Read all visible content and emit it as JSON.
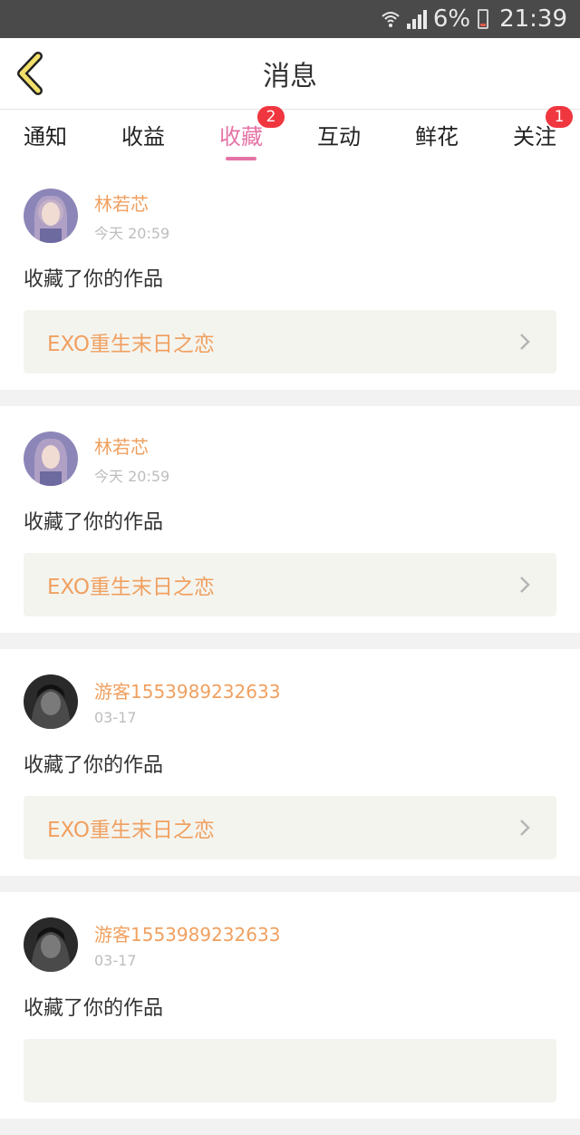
{
  "status_bar": {
    "battery_percent": "6%",
    "time": "21:39"
  },
  "header": {
    "title": "消息"
  },
  "tabs": [
    {
      "label": "通知",
      "active": false,
      "badge": ""
    },
    {
      "label": "收益",
      "active": false,
      "badge": ""
    },
    {
      "label": "收藏",
      "active": true,
      "badge": "2"
    },
    {
      "label": "互动",
      "active": false,
      "badge": ""
    },
    {
      "label": "鲜花",
      "active": false,
      "badge": ""
    },
    {
      "label": "关注",
      "active": false,
      "badge": "1"
    }
  ],
  "messages": [
    {
      "username": "林若芯",
      "time": "今天 20:59",
      "action": "收藏了你的作品",
      "work": "EXO重生末日之恋",
      "avatar": "light"
    },
    {
      "username": "林若芯",
      "time": "今天 20:59",
      "action": "收藏了你的作品",
      "work": "EXO重生末日之恋",
      "avatar": "light"
    },
    {
      "username": "游客1553989232633",
      "time": "03-17",
      "action": "收藏了你的作品",
      "work": "EXO重生末日之恋",
      "avatar": "dark"
    },
    {
      "username": "游客1553989232633",
      "time": "03-17",
      "action": "收藏了你的作品",
      "work": "",
      "avatar": "dark"
    }
  ],
  "colors": {
    "accent_pink": "#e573a6",
    "username_orange": "#f0a060",
    "badge_red": "#f0363f"
  }
}
